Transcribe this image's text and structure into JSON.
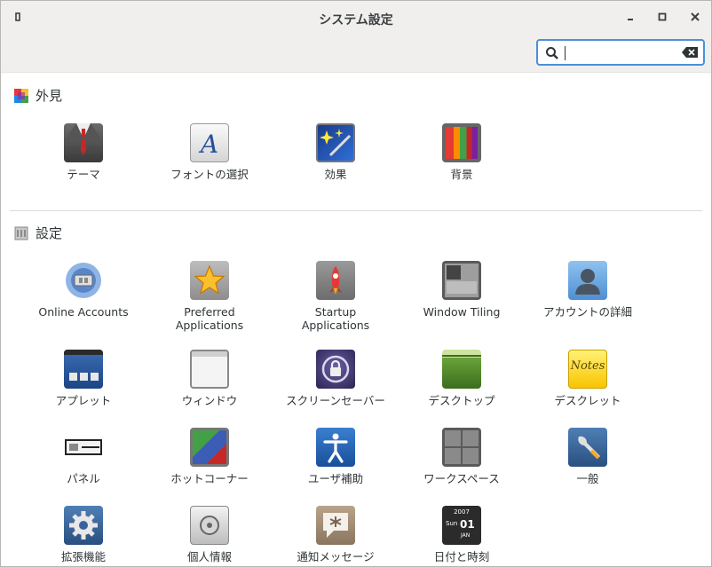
{
  "window": {
    "title": "システム設定"
  },
  "search": {
    "value": "",
    "placeholder": ""
  },
  "sections": [
    {
      "name": "外見",
      "items": [
        {
          "label": "テーマ",
          "icon": "theme-suit-icon"
        },
        {
          "label": "フォントの選択",
          "icon": "font-letter-a-icon"
        },
        {
          "label": "効果",
          "icon": "effects-sparkle-icon"
        },
        {
          "label": "背景",
          "icon": "background-stripes-icon"
        }
      ]
    },
    {
      "name": "設定",
      "items": [
        {
          "label": "Online Accounts",
          "icon": "online-accounts-icon"
        },
        {
          "label": "Preferred\nApplications",
          "icon": "star-icon"
        },
        {
          "label": "Startup\nApplications",
          "icon": "rocket-icon"
        },
        {
          "label": "Window Tiling",
          "icon": "window-tiling-icon"
        },
        {
          "label": "アカウントの詳細",
          "icon": "user-silhouette-icon"
        },
        {
          "label": "アプレット",
          "icon": "applets-icon"
        },
        {
          "label": "ウィンドウ",
          "icon": "window-icon"
        },
        {
          "label": "スクリーンセーバー",
          "icon": "lock-icon"
        },
        {
          "label": "デスクトップ",
          "icon": "desktop-icon"
        },
        {
          "label": "デスクレット",
          "icon": "note-icon"
        },
        {
          "label": "パネル",
          "icon": "panel-icon"
        },
        {
          "label": "ホットコーナー",
          "icon": "hot-corner-icon"
        },
        {
          "label": "ユーザ補助",
          "icon": "accessibility-icon"
        },
        {
          "label": "ワークスペース",
          "icon": "workspace-grid-icon"
        },
        {
          "label": "一般",
          "icon": "wrench-icon"
        },
        {
          "label": "拡張機能",
          "icon": "gear-icon"
        },
        {
          "label": "個人情報",
          "icon": "safe-icon"
        },
        {
          "label": "通知メッセージ",
          "icon": "notification-icon"
        },
        {
          "label": "日付と時刻",
          "icon": "calendar-icon",
          "detail": {
            "year": "2007",
            "weekday": "Sun",
            "day": "01",
            "month": "JAN"
          }
        }
      ]
    }
  ]
}
